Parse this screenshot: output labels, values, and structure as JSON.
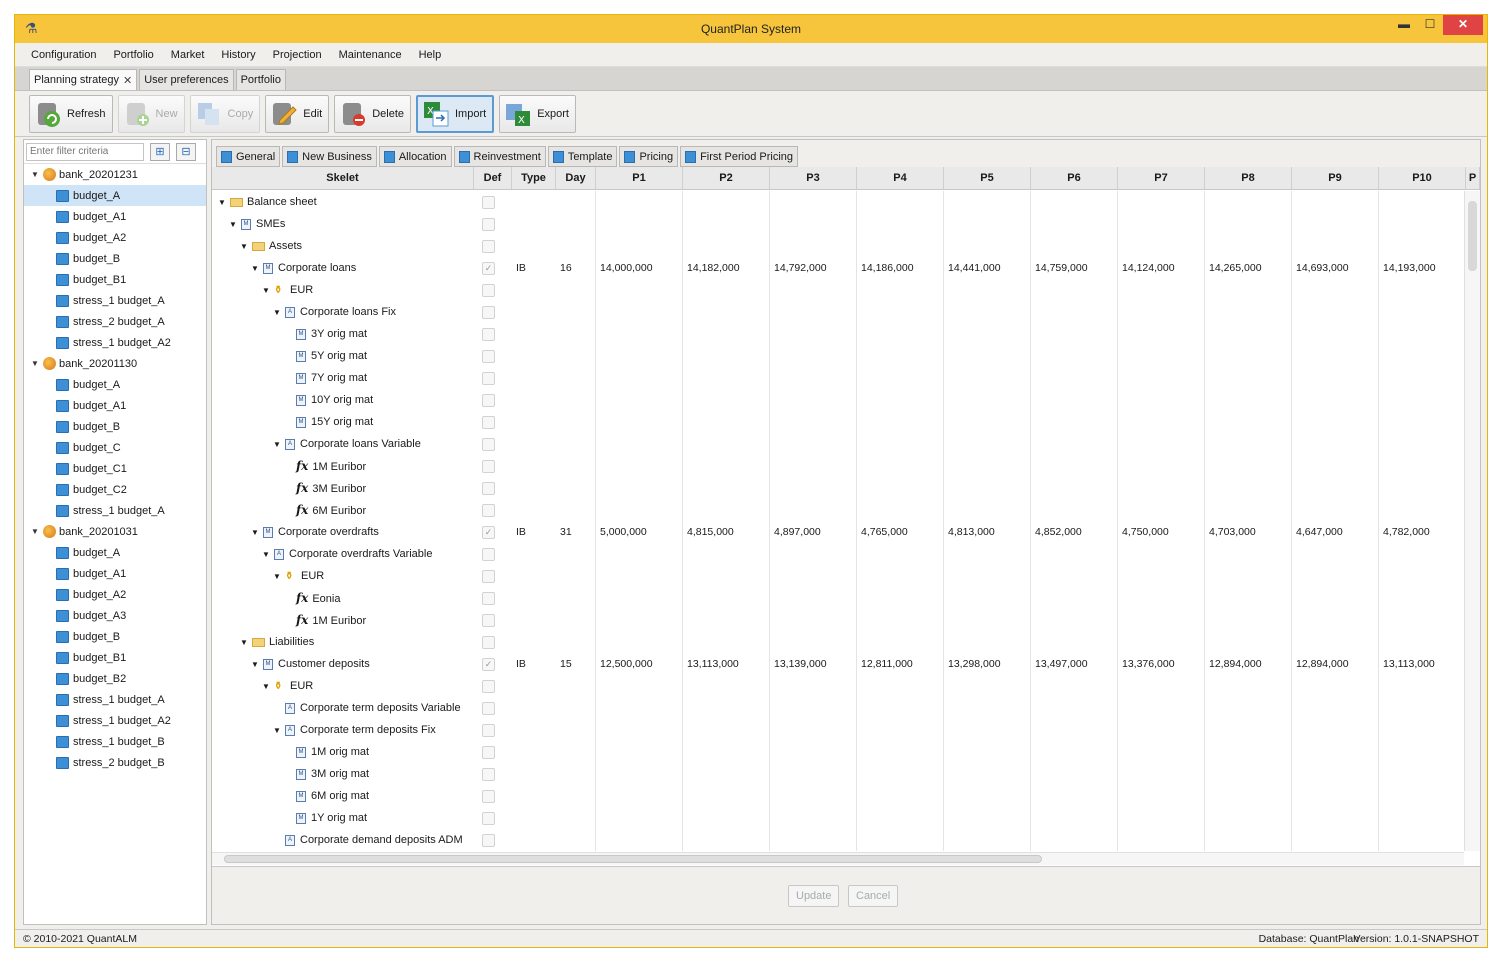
{
  "window": {
    "title": "QuantPlan System"
  },
  "menu": [
    "Configuration",
    "Portfolio",
    "Market",
    "History",
    "Projection",
    "Maintenance",
    "Help"
  ],
  "page_tabs": [
    {
      "label": "Planning strategy",
      "closable": true,
      "active": true
    },
    {
      "label": "User preferences",
      "closable": false,
      "active": false
    },
    {
      "label": "Portfolio",
      "closable": false,
      "active": false
    }
  ],
  "toolbar": {
    "refresh": "Refresh",
    "new": "New",
    "copy": "Copy",
    "edit": "Edit",
    "delete": "Delete",
    "import": "Import",
    "export": "Export"
  },
  "filter": {
    "placeholder": "Enter filter criteria",
    "expand_icon": "⊞",
    "collapse_icon": "⊟"
  },
  "tree": [
    {
      "kind": "bank",
      "label": "bank_20201231"
    },
    {
      "kind": "doc",
      "label": "budget_A",
      "selected": true
    },
    {
      "kind": "doc",
      "label": "budget_A1"
    },
    {
      "kind": "doc",
      "label": "budget_A2"
    },
    {
      "kind": "doc",
      "label": "budget_B"
    },
    {
      "kind": "doc",
      "label": "budget_B1"
    },
    {
      "kind": "doc",
      "label": "stress_1 budget_A"
    },
    {
      "kind": "doc",
      "label": "stress_2 budget_A"
    },
    {
      "kind": "doc",
      "label": "stress_1 budget_A2"
    },
    {
      "kind": "bank",
      "label": "bank_20201130"
    },
    {
      "kind": "doc",
      "label": "budget_A"
    },
    {
      "kind": "doc",
      "label": "budget_A1"
    },
    {
      "kind": "doc",
      "label": "budget_B"
    },
    {
      "kind": "doc",
      "label": "budget_C"
    },
    {
      "kind": "doc",
      "label": "budget_C1"
    },
    {
      "kind": "doc",
      "label": "budget_C2"
    },
    {
      "kind": "doc",
      "label": "stress_1 budget_A"
    },
    {
      "kind": "bank",
      "label": "bank_20201031"
    },
    {
      "kind": "doc",
      "label": "budget_A"
    },
    {
      "kind": "doc",
      "label": "budget_A1"
    },
    {
      "kind": "doc",
      "label": "budget_A2"
    },
    {
      "kind": "doc",
      "label": "budget_A3"
    },
    {
      "kind": "doc",
      "label": "budget_B"
    },
    {
      "kind": "doc",
      "label": "budget_B1"
    },
    {
      "kind": "doc",
      "label": "budget_B2"
    },
    {
      "kind": "doc",
      "label": "stress_1 budget_A"
    },
    {
      "kind": "doc",
      "label": "stress_1 budget_A2"
    },
    {
      "kind": "doc",
      "label": "stress_1 budget_B"
    },
    {
      "kind": "doc",
      "label": "stress_2 budget_B"
    }
  ],
  "sub_tabs": [
    "General",
    "New Business",
    "Allocation",
    "Reinvestment",
    "Template",
    "Pricing",
    "First Period Pricing"
  ],
  "grid": {
    "columns": [
      "Skelet",
      "Def",
      "Type",
      "Day",
      "P1",
      "P2",
      "P3",
      "P4",
      "P5",
      "P6",
      "P7",
      "P8",
      "P9",
      "P10",
      "P"
    ],
    "rows": [
      {
        "label": "Balance sheet",
        "icon": "folder",
        "level": 0,
        "caret": true,
        "def": false
      },
      {
        "label": "SMEs",
        "icon": "model",
        "level": 1,
        "caret": true,
        "def": false
      },
      {
        "label": "Assets",
        "icon": "folder",
        "level": 2,
        "caret": true,
        "def": false
      },
      {
        "label": "Corporate loans",
        "icon": "model",
        "level": 3,
        "caret": true,
        "def": true,
        "type": "IB",
        "day": "16",
        "values": [
          "14,000,000",
          "14,182,000",
          "14,792,000",
          "14,186,000",
          "14,441,000",
          "14,759,000",
          "14,124,000",
          "14,265,000",
          "14,693,000",
          "14,193,000"
        ]
      },
      {
        "label": "EUR",
        "icon": "currency",
        "level": 4,
        "caret": true,
        "def": false
      },
      {
        "label": "Corporate loans Fix",
        "icon": "account",
        "level": 5,
        "caret": true,
        "def": false
      },
      {
        "label": "3Y orig mat",
        "icon": "model",
        "level": 6,
        "caret": false,
        "def": false
      },
      {
        "label": "5Y orig mat",
        "icon": "model",
        "level": 6,
        "caret": false,
        "def": false
      },
      {
        "label": "7Y orig mat",
        "icon": "model",
        "level": 6,
        "caret": false,
        "def": false
      },
      {
        "label": "10Y orig mat",
        "icon": "model",
        "level": 6,
        "caret": false,
        "def": false
      },
      {
        "label": "15Y orig mat",
        "icon": "model",
        "level": 6,
        "caret": false,
        "def": false
      },
      {
        "label": "Corporate loans Variable",
        "icon": "account",
        "level": 5,
        "caret": true,
        "def": false
      },
      {
        "label": "1M Euribor",
        "icon": "fx",
        "level": 6,
        "caret": false,
        "def": false
      },
      {
        "label": "3M Euribor",
        "icon": "fx",
        "level": 6,
        "caret": false,
        "def": false
      },
      {
        "label": "6M Euribor",
        "icon": "fx",
        "level": 6,
        "caret": false,
        "def": false
      },
      {
        "label": "Corporate overdrafts",
        "icon": "model",
        "level": 3,
        "caret": true,
        "def": true,
        "type": "IB",
        "day": "31",
        "values": [
          "5,000,000",
          "4,815,000",
          "4,897,000",
          "4,765,000",
          "4,813,000",
          "4,852,000",
          "4,750,000",
          "4,703,000",
          "4,647,000",
          "4,782,000"
        ]
      },
      {
        "label": "Corporate overdrafts Variable",
        "icon": "account",
        "level": 4,
        "caret": true,
        "def": false
      },
      {
        "label": "EUR",
        "icon": "currency",
        "level": 5,
        "caret": true,
        "def": false
      },
      {
        "label": "Eonia",
        "icon": "fx",
        "level": 6,
        "caret": false,
        "def": false
      },
      {
        "label": "1M Euribor",
        "icon": "fx",
        "level": 6,
        "caret": false,
        "def": false
      },
      {
        "label": "Liabilities",
        "icon": "folder",
        "level": 2,
        "caret": true,
        "def": false
      },
      {
        "label": "Customer deposits",
        "icon": "model",
        "level": 3,
        "caret": true,
        "def": true,
        "type": "IB",
        "day": "15",
        "values": [
          "12,500,000",
          "13,113,000",
          "13,139,000",
          "12,811,000",
          "13,298,000",
          "13,497,000",
          "13,376,000",
          "12,894,000",
          "12,894,000",
          "13,113,000"
        ]
      },
      {
        "label": "EUR",
        "icon": "currency",
        "level": 4,
        "caret": true,
        "def": false
      },
      {
        "label": "Corporate term deposits Variable",
        "icon": "account",
        "level": 5,
        "caret": false,
        "def": false
      },
      {
        "label": "Corporate term deposits Fix",
        "icon": "account",
        "level": 5,
        "caret": true,
        "def": false
      },
      {
        "label": "1M orig mat",
        "icon": "model",
        "level": 6,
        "caret": false,
        "def": false
      },
      {
        "label": "3M orig mat",
        "icon": "model",
        "level": 6,
        "caret": false,
        "def": false
      },
      {
        "label": "6M orig mat",
        "icon": "model",
        "level": 6,
        "caret": false,
        "def": false
      },
      {
        "label": "1Y orig mat",
        "icon": "model",
        "level": 6,
        "caret": false,
        "def": false
      },
      {
        "label": "Corporate demand deposits ADM",
        "icon": "account",
        "level": 5,
        "caret": false,
        "def": false
      }
    ]
  },
  "actions": {
    "update": "Update",
    "cancel": "Cancel"
  },
  "status": {
    "copyright": "© 2010-2021 QuantALM",
    "database": "Database: QuantPlan",
    "version": "Version: 1.0.1-SNAPSHOT"
  },
  "colors": {
    "titlebar": "#f6c53b",
    "close": "#e04343",
    "selection": "#cfe4f7",
    "accent": "#3d8fd6"
  }
}
